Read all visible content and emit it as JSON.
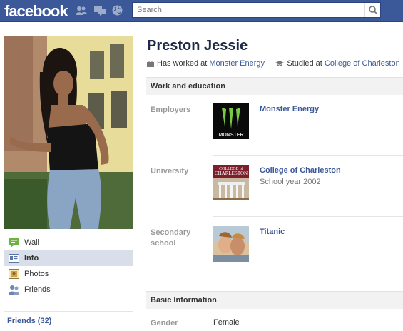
{
  "header": {
    "logo": "facebook",
    "search_placeholder": "Search"
  },
  "profile": {
    "name": "Preston Jessie",
    "worked_prefix": "Has worked at",
    "worked_org": "Monster Energy",
    "studied_prefix": "Studied at",
    "studied_org": "College of Charleston"
  },
  "sidebar": {
    "items": [
      {
        "label": "Wall",
        "icon": "wall-icon",
        "active": false
      },
      {
        "label": "Info",
        "icon": "info-icon",
        "active": true
      },
      {
        "label": "Photos",
        "icon": "photos-icon",
        "active": false
      },
      {
        "label": "Friends",
        "icon": "friends-icon",
        "active": false
      }
    ],
    "friends_link": "Friends (32)"
  },
  "work_education": {
    "title": "Work and education",
    "employers_label": "Employers",
    "employer": "Monster Energy",
    "employer_logo_text": "MONSTER",
    "university_label": "University",
    "university": "College of Charleston",
    "university_detail": "School year 2002",
    "university_logo_text_1": "COLLEGE of",
    "university_logo_text_2": "CHARLESTON",
    "secondary_label_1": "Secondary",
    "secondary_label_2": "school",
    "secondary": "Titanic"
  },
  "basic_info": {
    "title": "Basic Information",
    "gender_label": "Gender",
    "gender": "Female"
  },
  "colors": {
    "brand": "#3b5998",
    "section_bg": "#f2f2f2",
    "active_nav": "#d8dfea"
  }
}
